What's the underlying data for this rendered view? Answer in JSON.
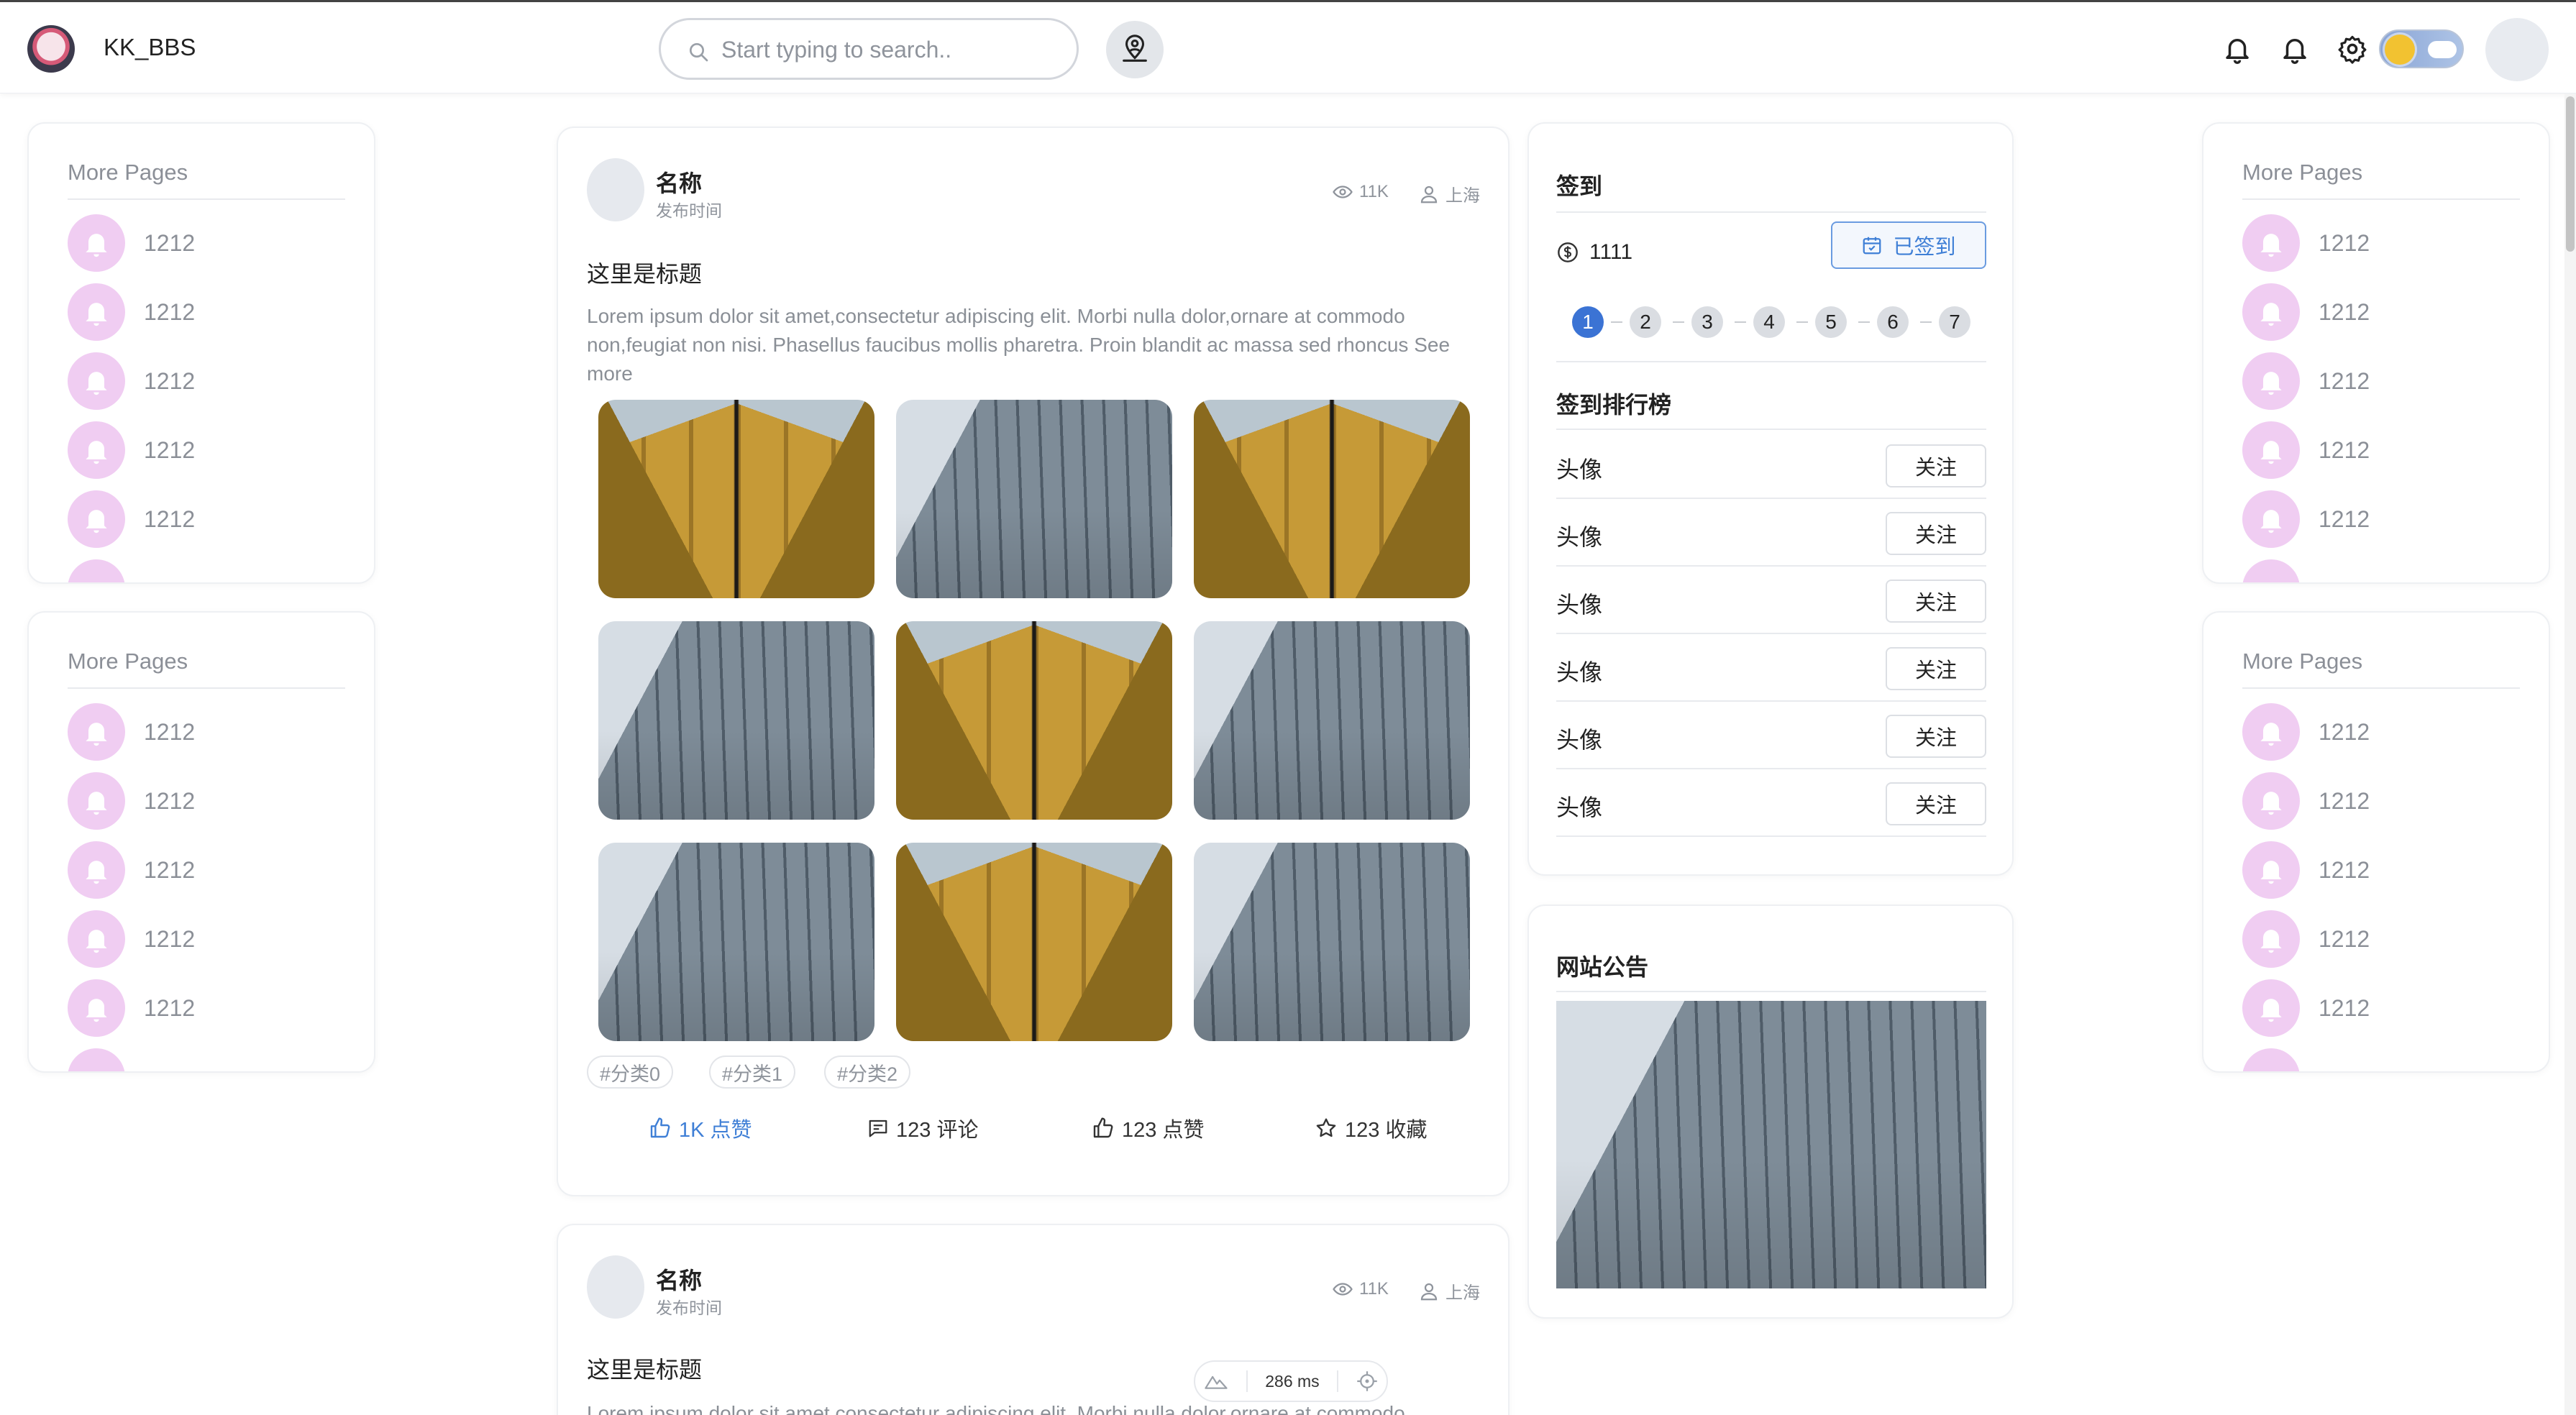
{
  "header": {
    "brand": "KK_BBS",
    "search_placeholder": "Start typing to search.."
  },
  "sidebar_left": [
    {
      "title": "More Pages",
      "items": [
        "1212",
        "1212",
        "1212",
        "1212",
        "1212"
      ]
    },
    {
      "title": "More Pages",
      "items": [
        "1212",
        "1212",
        "1212",
        "1212",
        "1212"
      ]
    }
  ],
  "sidebar_right": [
    {
      "title": "More Pages",
      "items": [
        "1212",
        "1212",
        "1212",
        "1212",
        "1212"
      ]
    },
    {
      "title": "More Pages",
      "items": [
        "1212",
        "1212",
        "1212",
        "1212",
        "1212"
      ]
    }
  ],
  "posts": [
    {
      "author": "名称",
      "time": "发布时间",
      "views": "11K",
      "location": "上海",
      "title": "这里是标题",
      "body": "Lorem ipsum dolor sit amet,consectetur adipiscing elit. Morbi nulla dolor,ornare at commodo non,feugiat non nisi. Phasellus faucibus mollis pharetra. Proin blandit ac massa sed rhoncus See more",
      "images": [
        "gold",
        "glass",
        "gold",
        "glass",
        "gold",
        "glass",
        "glass",
        "gold",
        "glass"
      ],
      "tags": [
        "#分类0",
        "#分类1",
        "#分类2"
      ],
      "actions": {
        "like": "1K 点赞",
        "comment": "123 评论",
        "thumb": "123 点赞",
        "collect": "123 收藏"
      }
    },
    {
      "author": "名称",
      "time": "发布时间",
      "views": "11K",
      "location": "上海",
      "title": "这里是标题",
      "body": "Lorem ipsum dolor sit amet,consectetur adipiscing elit. Morbi nulla dolor,ornare at commodo"
    }
  ],
  "checkin": {
    "title": "签到",
    "coins": "1111",
    "button": "已签到",
    "days": [
      "1",
      "2",
      "3",
      "4",
      "5",
      "6",
      "7"
    ],
    "completed_days": 1
  },
  "leaderboard": {
    "title": "签到排行榜",
    "rows": [
      {
        "name": "头像",
        "action": "关注"
      },
      {
        "name": "头像",
        "action": "关注"
      },
      {
        "name": "头像",
        "action": "关注"
      },
      {
        "name": "头像",
        "action": "关注"
      },
      {
        "name": "头像",
        "action": "关注"
      },
      {
        "name": "头像",
        "action": "关注"
      }
    ]
  },
  "notice": {
    "title": "网站公告"
  },
  "perf": {
    "latency": "286 ms"
  },
  "colors": {
    "accent": "#3f7fd6",
    "badge_pink": "#f0cdf2",
    "checkin_blue": "#3b73d4"
  },
  "icons": [
    "search-icon",
    "map-pin-user-icon",
    "bell-icon",
    "bell-icon",
    "gear-icon",
    "bell-avatar-icon",
    "eye-icon",
    "user-location-icon",
    "thumb-up-icon",
    "comment-icon",
    "star-icon",
    "coin-icon",
    "calendar-icon"
  ]
}
